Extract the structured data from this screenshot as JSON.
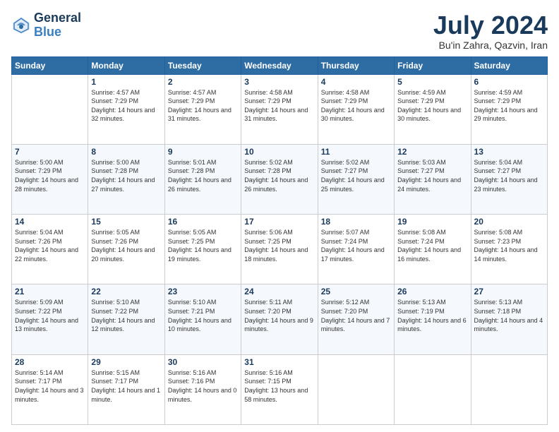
{
  "header": {
    "logo_line1": "General",
    "logo_line2": "Blue",
    "title": "July 2024",
    "subtitle": "Bu'in Zahra, Qazvin, Iran"
  },
  "days_of_week": [
    "Sunday",
    "Monday",
    "Tuesday",
    "Wednesday",
    "Thursday",
    "Friday",
    "Saturday"
  ],
  "weeks": [
    [
      {
        "day": "",
        "sunrise": "",
        "sunset": "",
        "daylight": ""
      },
      {
        "day": "1",
        "sunrise": "Sunrise: 4:57 AM",
        "sunset": "Sunset: 7:29 PM",
        "daylight": "Daylight: 14 hours and 32 minutes."
      },
      {
        "day": "2",
        "sunrise": "Sunrise: 4:57 AM",
        "sunset": "Sunset: 7:29 PM",
        "daylight": "Daylight: 14 hours and 31 minutes."
      },
      {
        "day": "3",
        "sunrise": "Sunrise: 4:58 AM",
        "sunset": "Sunset: 7:29 PM",
        "daylight": "Daylight: 14 hours and 31 minutes."
      },
      {
        "day": "4",
        "sunrise": "Sunrise: 4:58 AM",
        "sunset": "Sunset: 7:29 PM",
        "daylight": "Daylight: 14 hours and 30 minutes."
      },
      {
        "day": "5",
        "sunrise": "Sunrise: 4:59 AM",
        "sunset": "Sunset: 7:29 PM",
        "daylight": "Daylight: 14 hours and 30 minutes."
      },
      {
        "day": "6",
        "sunrise": "Sunrise: 4:59 AM",
        "sunset": "Sunset: 7:29 PM",
        "daylight": "Daylight: 14 hours and 29 minutes."
      }
    ],
    [
      {
        "day": "7",
        "sunrise": "Sunrise: 5:00 AM",
        "sunset": "Sunset: 7:29 PM",
        "daylight": "Daylight: 14 hours and 28 minutes."
      },
      {
        "day": "8",
        "sunrise": "Sunrise: 5:00 AM",
        "sunset": "Sunset: 7:28 PM",
        "daylight": "Daylight: 14 hours and 27 minutes."
      },
      {
        "day": "9",
        "sunrise": "Sunrise: 5:01 AM",
        "sunset": "Sunset: 7:28 PM",
        "daylight": "Daylight: 14 hours and 26 minutes."
      },
      {
        "day": "10",
        "sunrise": "Sunrise: 5:02 AM",
        "sunset": "Sunset: 7:28 PM",
        "daylight": "Daylight: 14 hours and 26 minutes."
      },
      {
        "day": "11",
        "sunrise": "Sunrise: 5:02 AM",
        "sunset": "Sunset: 7:27 PM",
        "daylight": "Daylight: 14 hours and 25 minutes."
      },
      {
        "day": "12",
        "sunrise": "Sunrise: 5:03 AM",
        "sunset": "Sunset: 7:27 PM",
        "daylight": "Daylight: 14 hours and 24 minutes."
      },
      {
        "day": "13",
        "sunrise": "Sunrise: 5:04 AM",
        "sunset": "Sunset: 7:27 PM",
        "daylight": "Daylight: 14 hours and 23 minutes."
      }
    ],
    [
      {
        "day": "14",
        "sunrise": "Sunrise: 5:04 AM",
        "sunset": "Sunset: 7:26 PM",
        "daylight": "Daylight: 14 hours and 22 minutes."
      },
      {
        "day": "15",
        "sunrise": "Sunrise: 5:05 AM",
        "sunset": "Sunset: 7:26 PM",
        "daylight": "Daylight: 14 hours and 20 minutes."
      },
      {
        "day": "16",
        "sunrise": "Sunrise: 5:05 AM",
        "sunset": "Sunset: 7:25 PM",
        "daylight": "Daylight: 14 hours and 19 minutes."
      },
      {
        "day": "17",
        "sunrise": "Sunrise: 5:06 AM",
        "sunset": "Sunset: 7:25 PM",
        "daylight": "Daylight: 14 hours and 18 minutes."
      },
      {
        "day": "18",
        "sunrise": "Sunrise: 5:07 AM",
        "sunset": "Sunset: 7:24 PM",
        "daylight": "Daylight: 14 hours and 17 minutes."
      },
      {
        "day": "19",
        "sunrise": "Sunrise: 5:08 AM",
        "sunset": "Sunset: 7:24 PM",
        "daylight": "Daylight: 14 hours and 16 minutes."
      },
      {
        "day": "20",
        "sunrise": "Sunrise: 5:08 AM",
        "sunset": "Sunset: 7:23 PM",
        "daylight": "Daylight: 14 hours and 14 minutes."
      }
    ],
    [
      {
        "day": "21",
        "sunrise": "Sunrise: 5:09 AM",
        "sunset": "Sunset: 7:22 PM",
        "daylight": "Daylight: 14 hours and 13 minutes."
      },
      {
        "day": "22",
        "sunrise": "Sunrise: 5:10 AM",
        "sunset": "Sunset: 7:22 PM",
        "daylight": "Daylight: 14 hours and 12 minutes."
      },
      {
        "day": "23",
        "sunrise": "Sunrise: 5:10 AM",
        "sunset": "Sunset: 7:21 PM",
        "daylight": "Daylight: 14 hours and 10 minutes."
      },
      {
        "day": "24",
        "sunrise": "Sunrise: 5:11 AM",
        "sunset": "Sunset: 7:20 PM",
        "daylight": "Daylight: 14 hours and 9 minutes."
      },
      {
        "day": "25",
        "sunrise": "Sunrise: 5:12 AM",
        "sunset": "Sunset: 7:20 PM",
        "daylight": "Daylight: 14 hours and 7 minutes."
      },
      {
        "day": "26",
        "sunrise": "Sunrise: 5:13 AM",
        "sunset": "Sunset: 7:19 PM",
        "daylight": "Daylight: 14 hours and 6 minutes."
      },
      {
        "day": "27",
        "sunrise": "Sunrise: 5:13 AM",
        "sunset": "Sunset: 7:18 PM",
        "daylight": "Daylight: 14 hours and 4 minutes."
      }
    ],
    [
      {
        "day": "28",
        "sunrise": "Sunrise: 5:14 AM",
        "sunset": "Sunset: 7:17 PM",
        "daylight": "Daylight: 14 hours and 3 minutes."
      },
      {
        "day": "29",
        "sunrise": "Sunrise: 5:15 AM",
        "sunset": "Sunset: 7:17 PM",
        "daylight": "Daylight: 14 hours and 1 minute."
      },
      {
        "day": "30",
        "sunrise": "Sunrise: 5:16 AM",
        "sunset": "Sunset: 7:16 PM",
        "daylight": "Daylight: 14 hours and 0 minutes."
      },
      {
        "day": "31",
        "sunrise": "Sunrise: 5:16 AM",
        "sunset": "Sunset: 7:15 PM",
        "daylight": "Daylight: 13 hours and 58 minutes."
      },
      {
        "day": "",
        "sunrise": "",
        "sunset": "",
        "daylight": ""
      },
      {
        "day": "",
        "sunrise": "",
        "sunset": "",
        "daylight": ""
      },
      {
        "day": "",
        "sunrise": "",
        "sunset": "",
        "daylight": ""
      }
    ]
  ]
}
